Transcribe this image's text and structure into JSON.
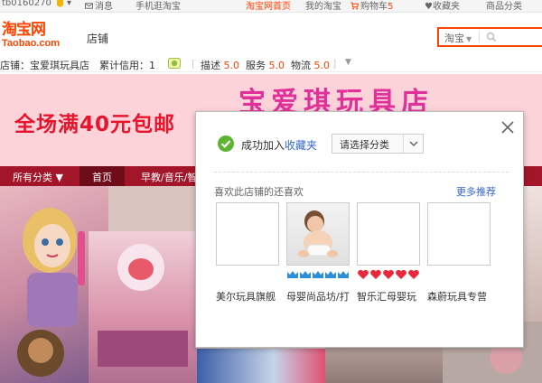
{
  "topbar": {
    "username": "tb0160270",
    "messages": "消息",
    "mobile": "手机逛淘宝",
    "home": "淘宝网首页",
    "my_taobao": "我的淘宝",
    "cart": "购物车",
    "cart_count": "5",
    "favorites": "收藏夹",
    "categories": "商品分类"
  },
  "header": {
    "logo_cn": "淘宝网",
    "logo_en": "Taobao.com",
    "shop_word": "店铺",
    "search_scope": "淘宝"
  },
  "shopinfo": {
    "shop_label": "店铺：",
    "shop_name": "宝爱琪玩具店",
    "credit_label": "累计信用：",
    "credit_value": "1",
    "desc_label": "描述",
    "desc_score": "5.0",
    "service_label": "服务",
    "service_score": "5.0",
    "logistics_label": "物流",
    "logistics_score": "5.0"
  },
  "banner": {
    "title": "宝爱琪玩具店",
    "promo": "全场满40元包邮"
  },
  "nav": {
    "all_categories": "所有分类",
    "home": "首页",
    "item3": "早教/音乐/智"
  },
  "popup": {
    "success_prefix": "成功加入",
    "success_link": "收藏夹",
    "category_select": "请选择分类",
    "rec_title": "喜欢此店铺的还喜欢",
    "rec_more": "更多推荐",
    "shops": [
      {
        "name": "美尔玩具旗舰"
      },
      {
        "name": "母婴尚品坊/打"
      },
      {
        "name": "智乐汇母婴玩"
      },
      {
        "name": "森蔚玩具专营"
      }
    ]
  },
  "colors": {
    "brand": "#ff4400",
    "nav_bg": "#a3162a",
    "link": "#3366cc",
    "success": "#5cb531"
  }
}
